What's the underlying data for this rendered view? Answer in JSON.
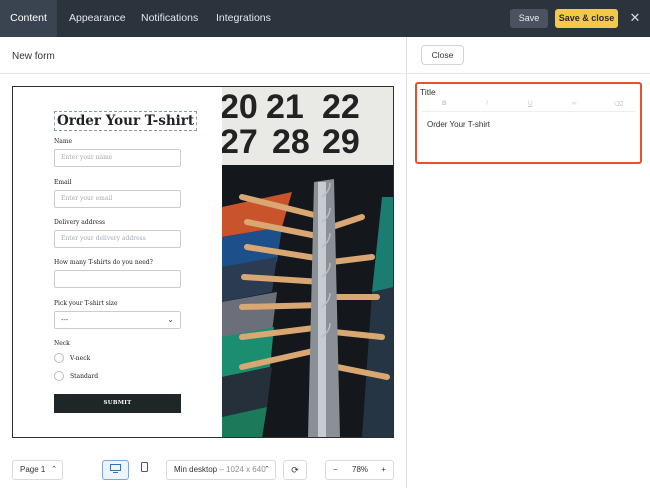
{
  "topbar": {
    "tabs": [
      {
        "label": "Content",
        "active": true
      },
      {
        "label": "Appearance",
        "active": false
      },
      {
        "label": "Notifications",
        "active": false
      },
      {
        "label": "Integrations",
        "active": false
      }
    ],
    "save_label": "Save",
    "save_close_label": "Save & close",
    "close_icon": "close-icon"
  },
  "editor": {
    "form_name": "New form"
  },
  "form": {
    "title": "Order Your T-shirt",
    "fields": [
      {
        "label": "Name",
        "placeholder": "Enter your name"
      },
      {
        "label": "Email",
        "placeholder": "Enter your email"
      },
      {
        "label": "Delivery address",
        "placeholder": "Enter your delivery address"
      },
      {
        "label": "How many T-shirts do you need?",
        "placeholder": ""
      }
    ],
    "size_label": "Pick your T-shirt size",
    "size_value": "---",
    "neck_label": "Neck",
    "neck_options": [
      "V-neck",
      "Standard"
    ],
    "submit_label": "SUBMIT"
  },
  "bottombar": {
    "page_label": "Page 1",
    "viewport_label": "Min desktop",
    "viewport_size": "– 1024 x 640",
    "zoom": "78%",
    "zoom_minus": "−",
    "zoom_plus": "+"
  },
  "panel": {
    "close_label": "Close",
    "title_label": "Title",
    "title_value": "Order Your T-shirt",
    "accent_color": "#e4532f"
  }
}
